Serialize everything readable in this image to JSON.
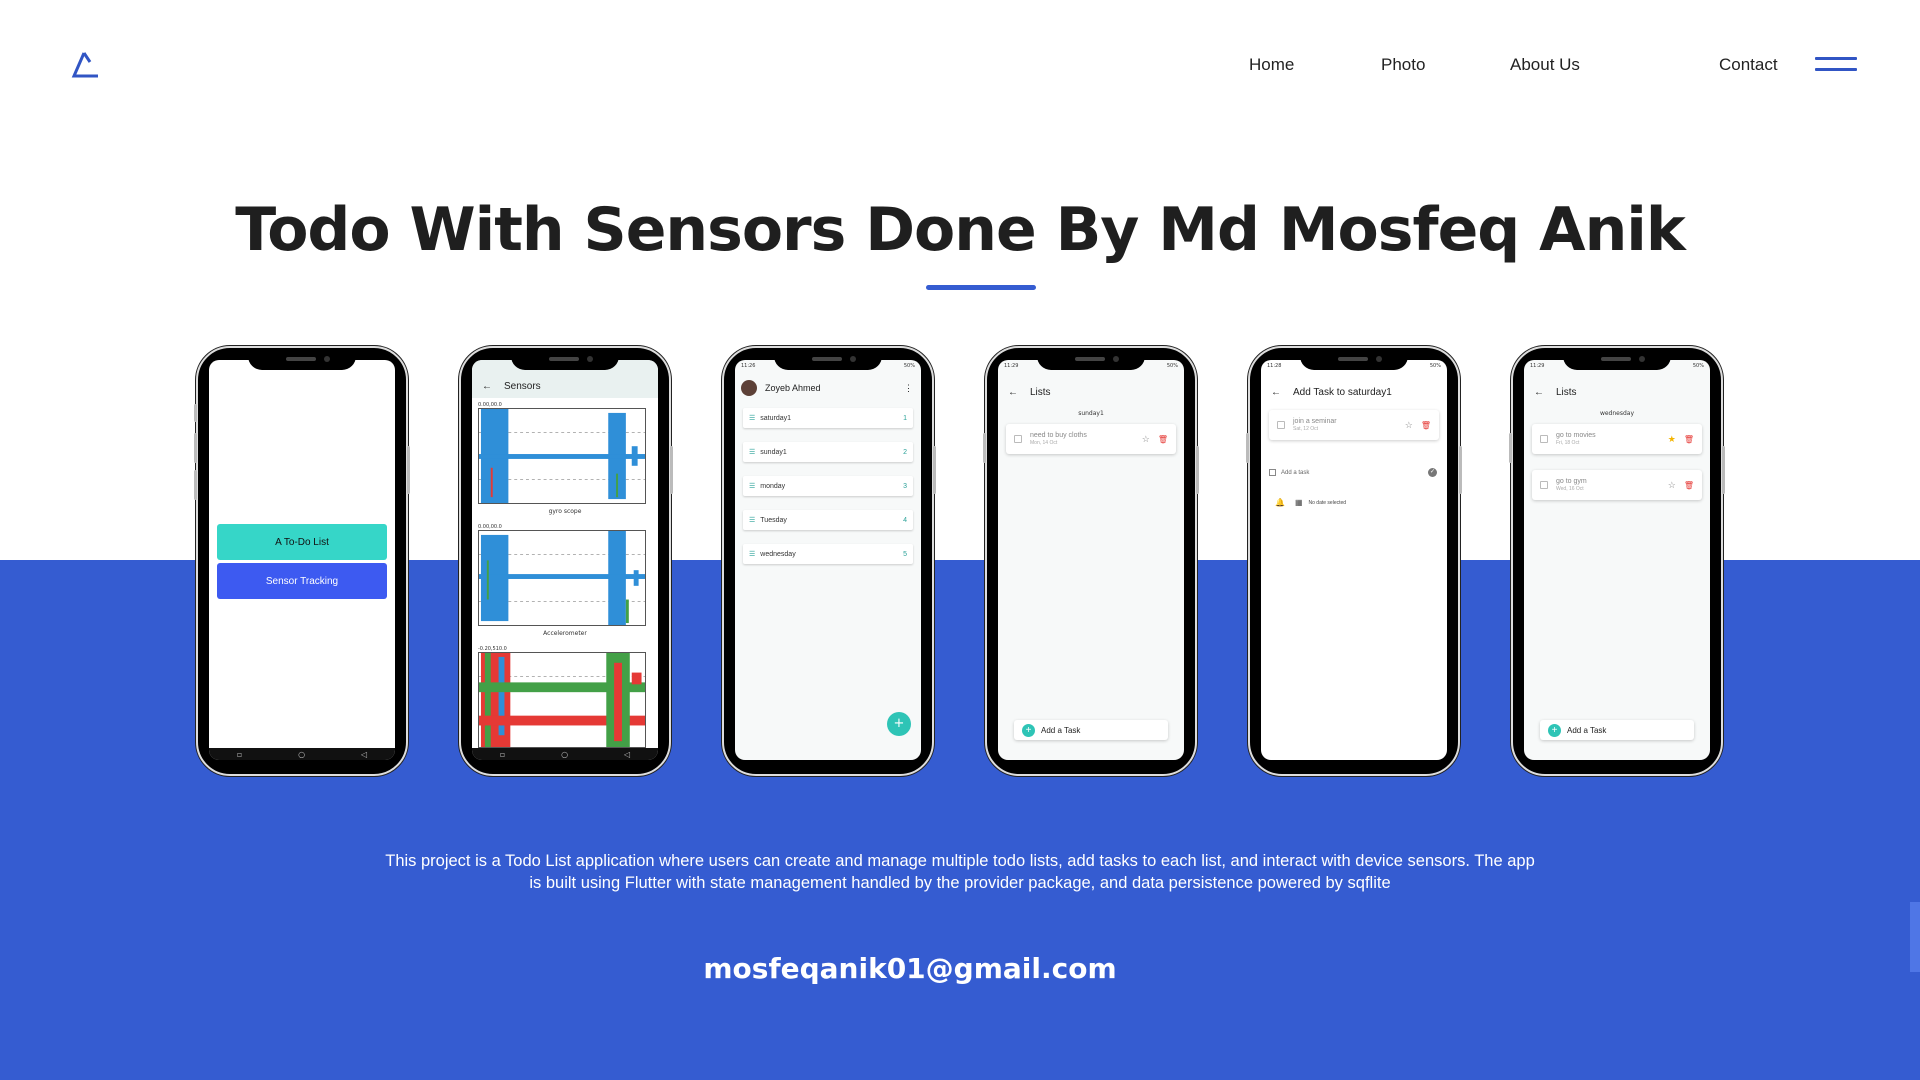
{
  "nav": {
    "home": "Home",
    "photo": "Photo",
    "about": "About Us",
    "contact": "Contact"
  },
  "heading": "Todo With Sensors Done By Md Mosfeq Anik",
  "description": "This project is a Todo List application where users can create and manage multiple todo lists, add tasks to each list, and interact with device sensors. The app is built using Flutter with state management handled by the provider package, and data persistence powered by sqflite",
  "email": "mosfeqanik01@gmail.com",
  "colors": {
    "brand_blue": "#355cd1",
    "teal": "#2ec4b6",
    "sensor_blue": "#3155f0"
  },
  "phones": {
    "p1": {
      "todo_button": "A To-Do List",
      "sensor_button": "Sensor Tracking"
    },
    "p2": {
      "title": "Sensors",
      "range1": "0.00,00.0",
      "caption1": "gyro scope",
      "range2": "0.00,00.0",
      "caption2": "Accelerometer",
      "range3": "-0.20,510.0"
    },
    "p3": {
      "user_name": "Zoyeb Ahmed",
      "status_time": "11:26",
      "status_battery": "50%",
      "lists": [
        {
          "name": "saturday1",
          "count": "1"
        },
        {
          "name": "sunday1",
          "count": "2"
        },
        {
          "name": "monday",
          "count": "3"
        },
        {
          "name": "Tuesday",
          "count": "4"
        },
        {
          "name": "wednesday",
          "count": "5"
        }
      ]
    },
    "p4": {
      "title": "Lists",
      "section": "sunday1",
      "task_title": "need to buy cloths",
      "task_date": "Mon, 14 Oct",
      "add_task": "Add a Task",
      "status_time": "11:29",
      "status_battery": "50%"
    },
    "p5": {
      "title": "Add Task to saturday1",
      "task_title": "join a seminar",
      "task_date": "Sat, 12 Oct",
      "add_a_task": "Add a task",
      "no_date": "No date selected",
      "status_time": "11:28",
      "status_battery": "50%"
    },
    "p6": {
      "title": "Lists",
      "section": "wednesday",
      "task1_title": "go to movies",
      "task1_date": "Fri, 18 Oct",
      "task2_title": "go to gym",
      "task2_date": "Wed, 16 Oct",
      "add_task": "Add a Task",
      "status_time": "11:29",
      "status_battery": "50%"
    }
  }
}
